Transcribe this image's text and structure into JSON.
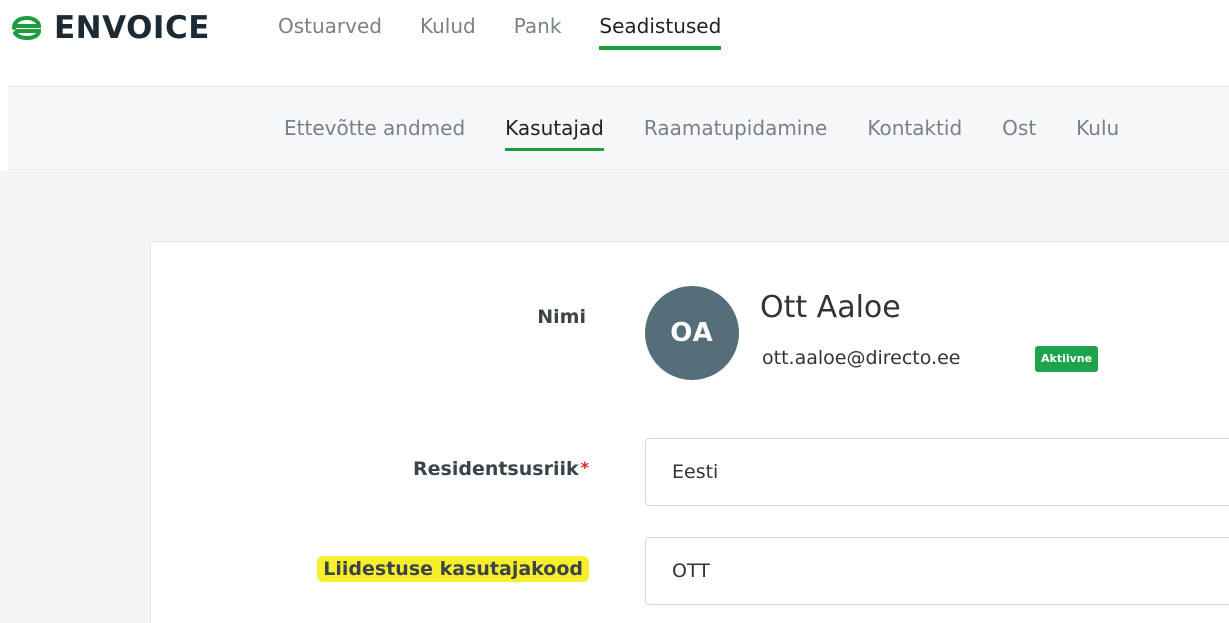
{
  "brand": {
    "name": "ENVOICE",
    "color": "#1a9c3f"
  },
  "mainnav": {
    "items": [
      {
        "label": "Ostuarved",
        "active": false
      },
      {
        "label": "Kulud",
        "active": false
      },
      {
        "label": "Pank",
        "active": false
      },
      {
        "label": "Seadistused",
        "active": true
      }
    ]
  },
  "subnav": {
    "items": [
      {
        "label": "Ettevõtte andmed",
        "active": false
      },
      {
        "label": "Kasutajad",
        "active": true
      },
      {
        "label": "Raamatupidamine",
        "active": false
      },
      {
        "label": "Kontaktid",
        "active": false
      },
      {
        "label": "Ost",
        "active": false
      },
      {
        "label": "Kulu",
        "active": false
      }
    ]
  },
  "user": {
    "name_label": "Nimi",
    "initials": "OA",
    "full_name": "Ott Aaloe",
    "email": "ott.aaloe@directo.ee",
    "status": "Aktiivne"
  },
  "form": {
    "residency_label": "Residentsusriik",
    "residency_required_mark": "*",
    "residency_value": "Eesti",
    "interface_code_label": "Liidestuse kasutajakood",
    "interface_code_value": "OTT"
  },
  "colors": {
    "accent": "#1a9c3f",
    "avatar_bg": "#546e7a",
    "highlight": "#f7ef2c",
    "required": "#e0202a"
  }
}
